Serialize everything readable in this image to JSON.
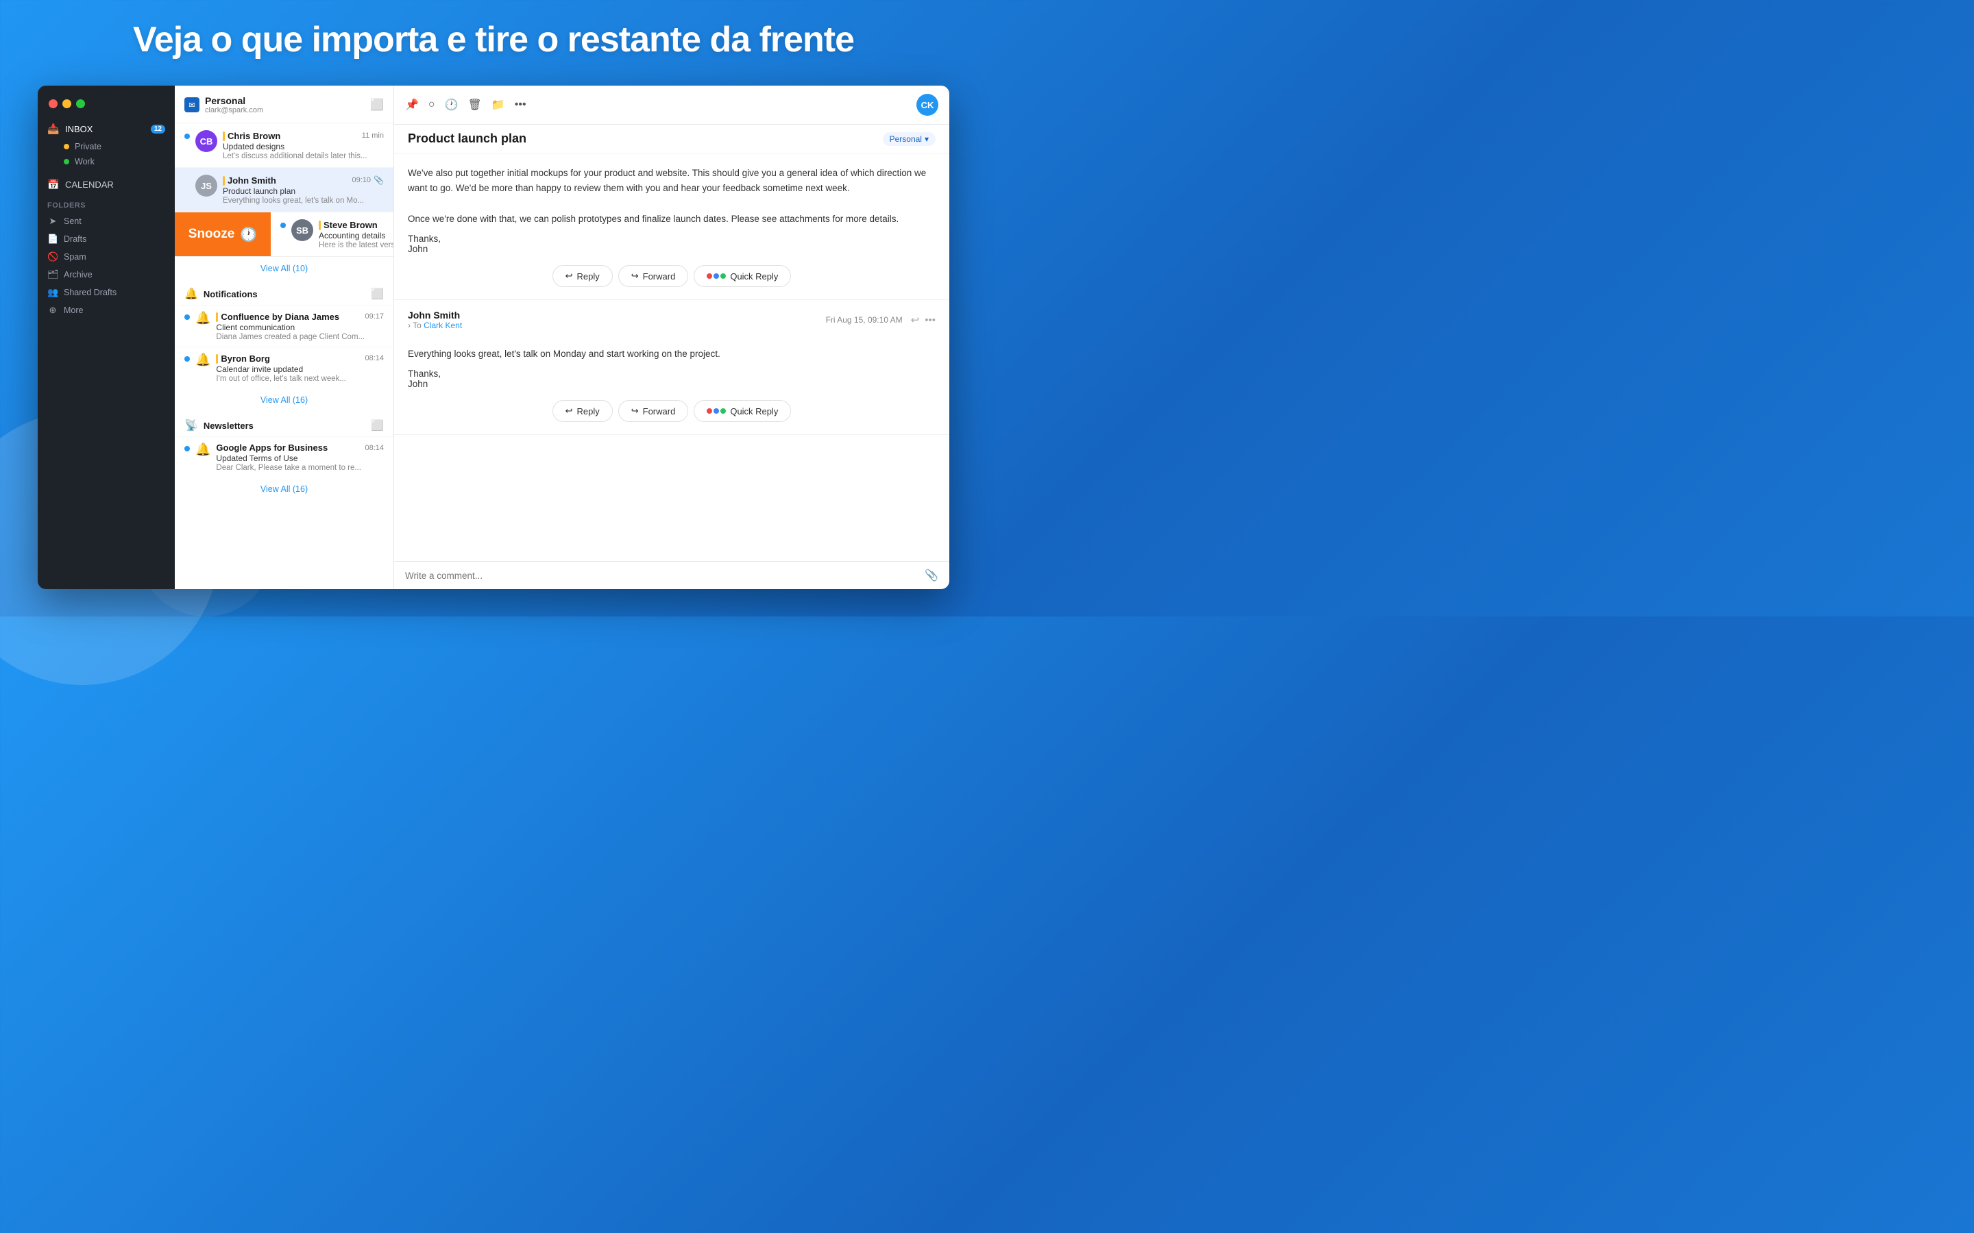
{
  "hero": {
    "title": "Veja o que importa e tire o restante da frente"
  },
  "sidebar": {
    "inbox_label": "INBOX",
    "inbox_badge": "12",
    "private_label": "Private",
    "work_label": "Work",
    "calendar_label": "CALENDAR",
    "folders_label": "Folders",
    "sent_label": "Sent",
    "drafts_label": "Drafts",
    "spam_label": "Spam",
    "archive_label": "Archive",
    "shared_drafts_label": "Shared Drafts",
    "more_label": "More"
  },
  "personal_header": {
    "account_name": "Personal",
    "account_email": "clark@spark.com"
  },
  "emails": [
    {
      "sender": "Chris Brown",
      "time": "11 min",
      "subject": "Updated designs",
      "preview": "Let's discuss additional details later this...",
      "priority": "yellow",
      "unread": true
    },
    {
      "sender": "John Smith",
      "time": "09:10",
      "subject": "Product launch plan",
      "preview": "Everything looks great, let's talk on Mo...",
      "priority": "yellow",
      "unread": false,
      "selected": true,
      "has_attachment": true
    },
    {
      "sender": "Steve Brown",
      "time": "",
      "subject": "Accounting details",
      "preview": "Here is the latest versio",
      "priority": "yellow",
      "unread": true
    }
  ],
  "snooze": {
    "label": "Snooze"
  },
  "view_all_personal": "View All (10)",
  "notifications": {
    "title": "Notifications",
    "items": [
      {
        "sender": "Confluence by Diana James",
        "time": "09:17",
        "subject": "Client communication",
        "preview": "Diana James created a page Client Com...",
        "unread": true
      },
      {
        "sender": "Byron Borg",
        "time": "08:14",
        "subject": "Calendar invite updated",
        "preview": "I'm out of office, let's talk next week...",
        "unread": true,
        "priority": "yellow"
      }
    ],
    "view_all": "View All (16)"
  },
  "newsletters": {
    "title": "Newsletters",
    "items": [
      {
        "sender": "Google Apps for Business",
        "time": "08:14",
        "subject": "Updated Terms of Use",
        "preview": "Dear Clark, Please take a moment to re...",
        "unread": true
      }
    ],
    "view_all": "View All (16)"
  },
  "reader": {
    "subject": "Product launch plan",
    "tag": "Personal",
    "message1": {
      "body_p1": "We've also put together initial mockups for your product and website. This should give you a general idea of which direction we want to go. We'd be more than happy to review them with you and hear your feedback sometime next week.",
      "body_p2": "Once we're done with that, we can polish prototypes and finalize launch dates. Please see attachments for more details.",
      "signature": "Thanks,\nJohn"
    },
    "message2": {
      "sender": "John Smith",
      "to": "Clark Kent",
      "date": "Fri Aug 15, 09:10 AM",
      "body": "Everything looks great, let's talk on Monday and start working on the project.",
      "signature": "Thanks,\nJohn"
    },
    "reply_label": "Reply",
    "forward_label": "Forward",
    "quick_reply_label": "Quick Reply",
    "comment_placeholder": "Write a comment..."
  }
}
